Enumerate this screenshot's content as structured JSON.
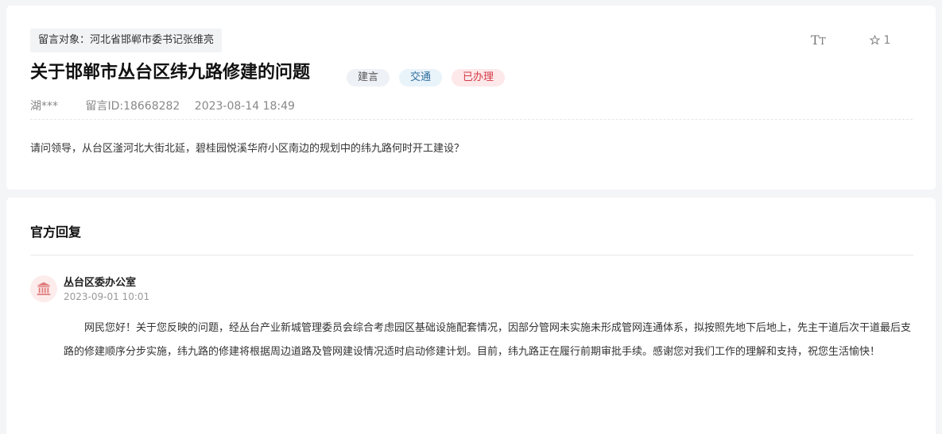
{
  "question": {
    "target": "留言对象：河北省邯郸市委书记张维亮",
    "title": "关于邯郸市丛台区纬九路修建的问题",
    "badges": {
      "type": "建言",
      "category": "交通",
      "status": "已办理"
    },
    "author": "湖***",
    "message_id": "留言ID:18668282",
    "datetime": "2023-08-14 18:49",
    "content": "请问领导，从台区滏河北大街北延，碧桂园悦溪华府小区南边的规划中的纬九路何时开工建设？",
    "toolbar": {
      "font_size_glyph": "T",
      "font_size_glyph_small": "T",
      "star_count": "1"
    }
  },
  "reply": {
    "header": "官方回复",
    "office": "丛台区委办公室",
    "datetime": "2023-09-01 10:01",
    "body": "网民您好！关于您反映的问题，经丛台产业新城管理委员会综合考虑园区基础设施配套情况，因部分管网未实施未形成管网连通体系，拟按照先地下后地上，先主干道后次干道最后支路的修建顺序分步实施，纬九路的修建将根据周边道路及管网建设情况适时启动修建计划。目前，纬九路正在履行前期审批手续。感谢您对我们工作的理解和支持，祝您生活愉快！"
  },
  "icons": {
    "font_size": "font-size-icon",
    "star": "star-icon",
    "office": "government-building-icon"
  },
  "colors": {
    "badge_type_bg": "#eef1f6",
    "badge_category_bg": "#e9f3fa",
    "badge_status_bg": "#fde8ea",
    "badge_status_text": "#d33a45",
    "avatar_bg": "#fdecec",
    "avatar_icon": "#e07a7a"
  }
}
